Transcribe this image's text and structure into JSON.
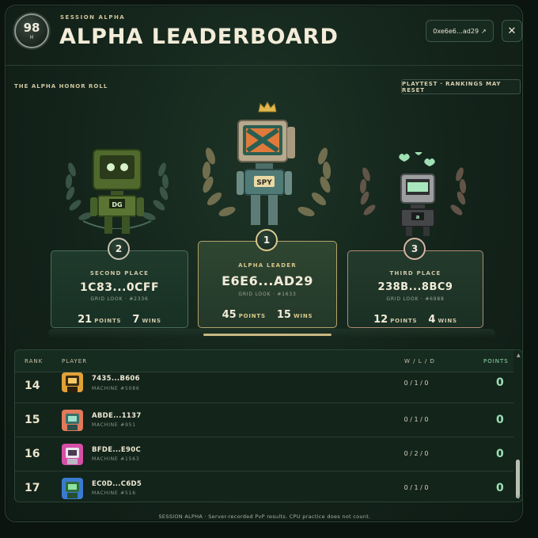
{
  "header": {
    "badge_value": "98",
    "badge_unit": "M",
    "session_label": "SESSION ALPHA",
    "title": "ALPHA LEADERBOARD",
    "wallet_label": "0xe6e6…ad29",
    "wallet_icon": "external-link-icon",
    "close_icon": "close-icon",
    "close_glyph": "✕"
  },
  "honor_roll": {
    "title": "THE ALPHA HONOR ROLL",
    "notice": "PLAYTEST · RANKINGS MAY RESET"
  },
  "podium": {
    "second": {
      "rank": "2",
      "place_label": "SECOND PLACE",
      "name": "1C83...0CFF",
      "grid_look": "GRID LOOK · #2336",
      "points": "21",
      "points_unit": "POINTS",
      "wins": "7",
      "wins_unit": "WINS"
    },
    "first": {
      "rank": "1",
      "place_label": "ALPHA LEADER",
      "name": "E6E6...AD29",
      "grid_look": "GRID LOOK · #1633",
      "points": "45",
      "points_unit": "POINTS",
      "wins": "15",
      "wins_unit": "WINS"
    },
    "third": {
      "rank": "3",
      "place_label": "THIRD PLACE",
      "name": "238B...8BC9",
      "grid_look": "GRID LOOK · #6988",
      "points": "12",
      "points_unit": "POINTS",
      "wins": "4",
      "wins_unit": "WINS"
    },
    "robot_screen_text_first": "SPY"
  },
  "table": {
    "headers": {
      "rank": "RANK",
      "player": "PLAYER",
      "wld": "W / L / D",
      "points": "POINTS"
    },
    "rows": [
      {
        "rank": "14",
        "name": "7435...B606",
        "machine": "MACHINE #5086",
        "wld": "0 / 1 / 0",
        "points": "0",
        "avatar_color": "#e0a236"
      },
      {
        "rank": "15",
        "name": "ABDE...1137",
        "machine": "MACHINE #951",
        "wld": "0 / 1 / 0",
        "points": "0",
        "avatar_color": "#e07a5a"
      },
      {
        "rank": "16",
        "name": "BFDE...E90C",
        "machine": "MACHINE #1563",
        "wld": "0 / 2 / 0",
        "points": "0",
        "avatar_color": "#d54fa8"
      },
      {
        "rank": "17",
        "name": "EC0D...C6D5",
        "machine": "MACHINE #516",
        "wld": "0 / 1 / 0",
        "points": "0",
        "avatar_color": "#3a7bd0"
      }
    ]
  },
  "footer": "SESSION ALPHA · Server-recorded PvP results. CPU practice does not count.",
  "colors": {
    "background": "#13231a",
    "accent_gold": "#c9b883",
    "points_green": "#9fe0b4"
  }
}
